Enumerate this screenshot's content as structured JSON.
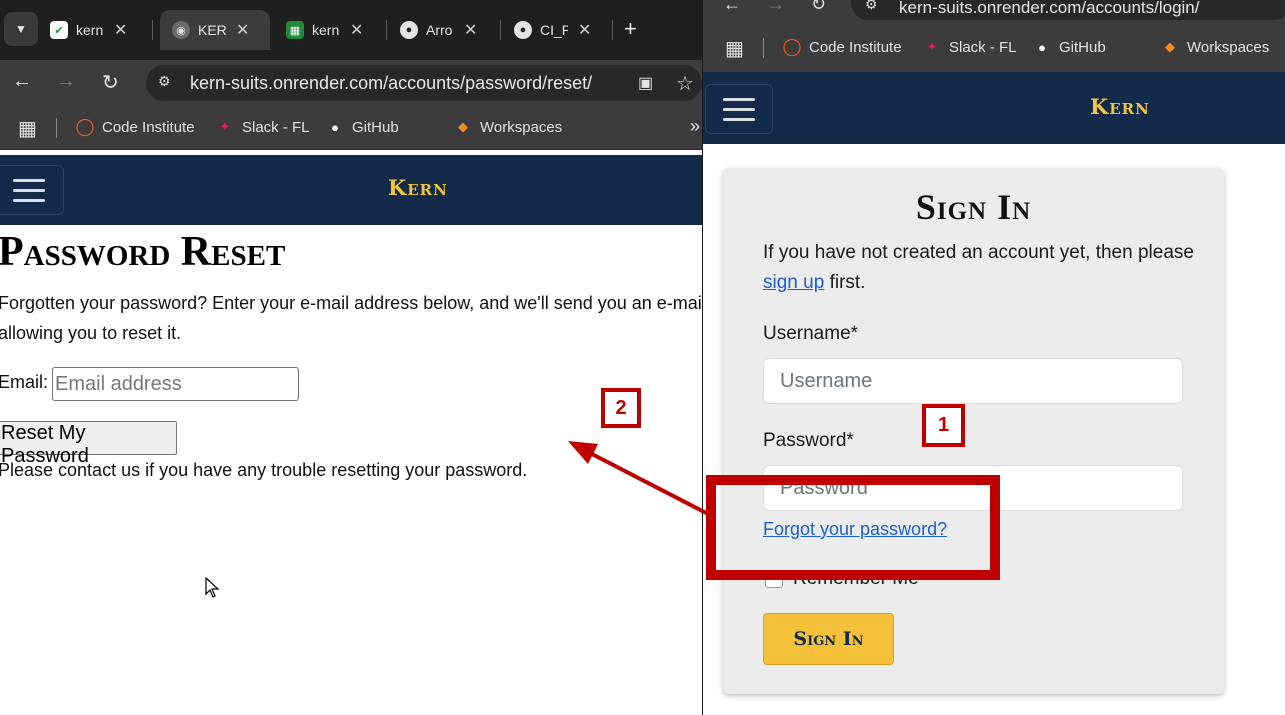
{
  "left_window": {
    "tabs": [
      {
        "title": "kern",
        "favicon": "kern-favicon-icon"
      },
      {
        "title": "KERN",
        "favicon": "globe-icon",
        "active": true
      },
      {
        "title": "kern",
        "favicon": "green-sheet-icon"
      },
      {
        "title": "Arro",
        "favicon": "github-icon"
      },
      {
        "title": "CI_P",
        "favicon": "github-icon"
      }
    ],
    "url": "kern-suits.onrender.com/accounts/password/reset/",
    "bookmarks": [
      "Code Institute",
      "Slack - FL",
      "GitHub",
      "Workspaces"
    ],
    "overflow_label": "»",
    "brand": "Kern",
    "page": {
      "title": "Password Reset",
      "intro": "Forgotten your password? Enter your e-mail address below, and we'll send you an e-mail allowing you to reset it.",
      "email_label": "Email:",
      "email_placeholder": "Email address",
      "button_label": "Reset My Password",
      "contact_text": "Please contact us if you have any trouble resetting your password."
    }
  },
  "right_window": {
    "url": "kern-suits.onrender.com/accounts/login/",
    "bookmarks": [
      "Code Institute",
      "Slack - FL",
      "GitHub",
      "Workspaces"
    ],
    "brand": "Kern",
    "signin": {
      "title": "Sign In",
      "intro_before": "If you have not created an account yet, then please",
      "signup_link": "sign up",
      "intro_after": "first.",
      "username_label": "Username*",
      "username_placeholder": "Username",
      "password_label": "Password*",
      "password_placeholder": "Password",
      "forgot_link": "Forgot your password?",
      "remember_label": "Remember Me",
      "button_label": "Sign In"
    }
  },
  "annotations": {
    "badge_1": "1",
    "badge_2": "2",
    "color": "#c00000"
  },
  "colors": {
    "navbar": "#142a4a",
    "brand_gold": "#f2c53d",
    "button_yellow": "#f5c03a",
    "link_blue": "#1a5fd6"
  }
}
